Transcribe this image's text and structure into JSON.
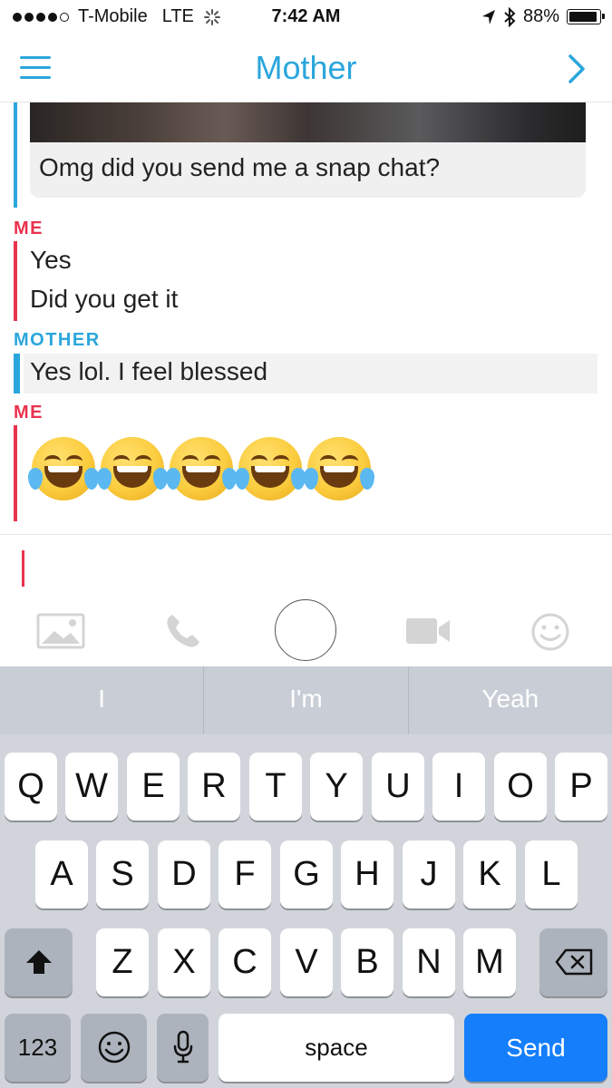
{
  "status_bar": {
    "carrier": "T-Mobile",
    "network": "LTE",
    "time": "7:42 AM",
    "battery": "88%",
    "signal_bars_filled": 4,
    "signal_bars_total": 5
  },
  "header": {
    "title": "Mother",
    "menu_icon": "hamburger-menu-icon",
    "next_icon": "chevron-right-icon"
  },
  "chat": {
    "media_caption": "Omg did you send me a snap chat?",
    "groups": [
      {
        "sender": "ME",
        "messages": [
          "Yes",
          "Did you get it"
        ]
      },
      {
        "sender": "MOTHER",
        "messages": [
          "Yes lol. I feel blessed"
        ]
      },
      {
        "sender": "ME",
        "emoji": "face-with-tears-of-joy",
        "emoji_count": 5
      }
    ]
  },
  "composer": {
    "text": "",
    "toolbar_icons": [
      "image-icon",
      "phone-icon",
      "capture-button",
      "video-icon",
      "emoji-icon"
    ]
  },
  "suggestions": [
    "I",
    "I'm",
    "Yeah"
  ],
  "keyboard": {
    "row1": [
      "Q",
      "W",
      "E",
      "R",
      "T",
      "Y",
      "U",
      "I",
      "O",
      "P"
    ],
    "row2": [
      "A",
      "S",
      "D",
      "F",
      "G",
      "H",
      "J",
      "K",
      "L"
    ],
    "row3": [
      "Z",
      "X",
      "C",
      "V",
      "B",
      "N",
      "M"
    ],
    "numbers_label": "123",
    "space_label": "space",
    "send_label": "Send"
  },
  "colors": {
    "me": "#e8334e",
    "mother": "#2ba6dc",
    "send": "#147efb"
  }
}
